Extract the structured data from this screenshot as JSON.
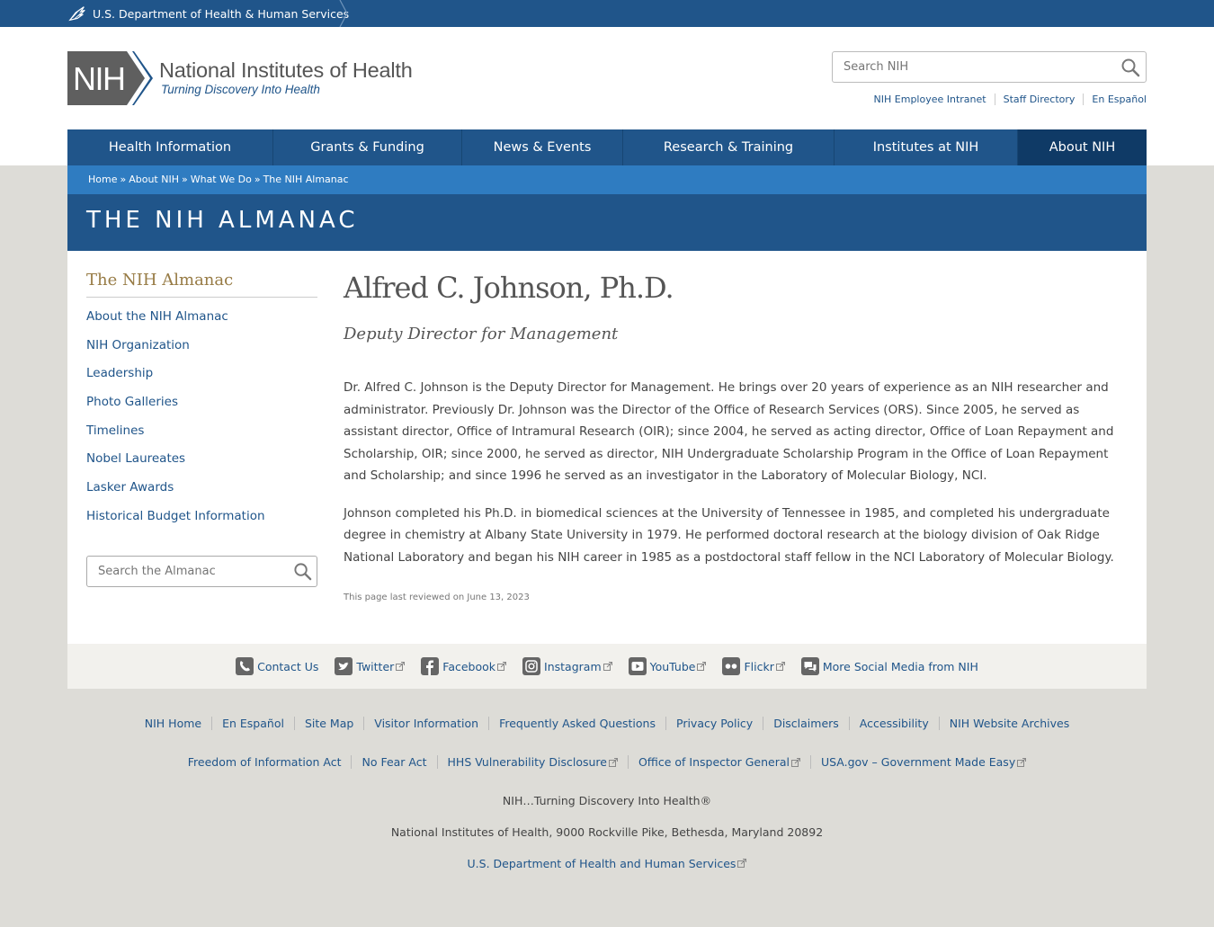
{
  "hhs": {
    "label": "U.S. Department of Health & Human Services"
  },
  "logo": {
    "mark": "NIH",
    "name": "National Institutes of Health",
    "tagline": "Turning Discovery Into Health"
  },
  "search": {
    "placeholder": "Search NIH"
  },
  "util_links": [
    "NIH Employee Intranet",
    "Staff Directory",
    "En Español"
  ],
  "nav": [
    "Health Information",
    "Grants & Funding",
    "News & Events",
    "Research & Training",
    "Institutes at NIH",
    "About NIH"
  ],
  "breadcrumb": [
    "Home",
    "About NIH",
    "What We Do",
    "The NIH Almanac"
  ],
  "banner_title": "THE NIH ALMANAC",
  "sidebar": {
    "title": "The NIH Almanac",
    "items": [
      "About the NIH Almanac",
      "NIH Organization",
      "Leadership",
      "Photo Galleries",
      "Timelines",
      "Nobel Laureates",
      "Lasker Awards",
      "Historical Budget Information"
    ],
    "search_placeholder": "Search the Almanac"
  },
  "main": {
    "name": "Alfred C. Johnson, Ph.D.",
    "role": "Deputy Director for Management",
    "para1": "Dr. Alfred C. Johnson is the Deputy Director for Management. He brings over 20 years of experience as an NIH researcher and administrator. Previously Dr. Johnson was the Director of the Office of Research Services (ORS). Since 2005, he served as assistant director, Office of Intramural Research (OIR); since 2004, he served as acting director, Office of Loan Repayment and Scholarship, OIR; since 2000, he served as director, NIH Undergraduate Scholarship Program in the Office of Loan Repayment and Scholarship; and since 1996 he served as an investigator in the Laboratory of Molecular Biology, NCI.",
    "para2": "Johnson completed his Ph.D. in biomedical sciences at the University of Tennessee in 1985, and completed his undergraduate degree in chemistry at Albany State University in 1979. He performed doctoral research at the biology division of Oak Ridge National Laboratory and began his NIH career in 1985 as a postdoctoral staff fellow in the NCI Laboratory of Molecular Biology.",
    "reviewed": "This page last reviewed on June 13, 2023"
  },
  "social": [
    {
      "label": "Contact Us",
      "icon": "phone-icon"
    },
    {
      "label": "Twitter",
      "icon": "twitter-icon"
    },
    {
      "label": "Facebook",
      "icon": "facebook-icon"
    },
    {
      "label": "Instagram",
      "icon": "instagram-icon"
    },
    {
      "label": "YouTube",
      "icon": "youtube-icon"
    },
    {
      "label": "Flickr",
      "icon": "flickr-icon"
    },
    {
      "label": "More Social Media from NIH",
      "icon": "chat-icon"
    }
  ],
  "footer_row1": [
    "NIH Home",
    "En Español",
    "Site Map",
    "Visitor Information",
    "Frequently Asked Questions",
    "Privacy Policy",
    "Disclaimers",
    "Accessibility",
    "NIH Website Archives"
  ],
  "footer_row2": [
    "Freedom of Information Act",
    "No Fear Act",
    "HHS Vulnerability Disclosure",
    "Office of Inspector General",
    "USA.gov – Government Made Easy"
  ],
  "footer_tagline": "NIH…Turning Discovery Into Health®",
  "footer_address": "National Institutes of Health, 9000 Rockville Pike, Bethesda, Maryland 20892",
  "footer_hhs": "U.S. Department of Health and Human Services",
  "colors": {
    "primary": "#20558a",
    "accent_blue": "#2f7cc1",
    "gold": "#977b45",
    "background": "#dddcd7"
  }
}
